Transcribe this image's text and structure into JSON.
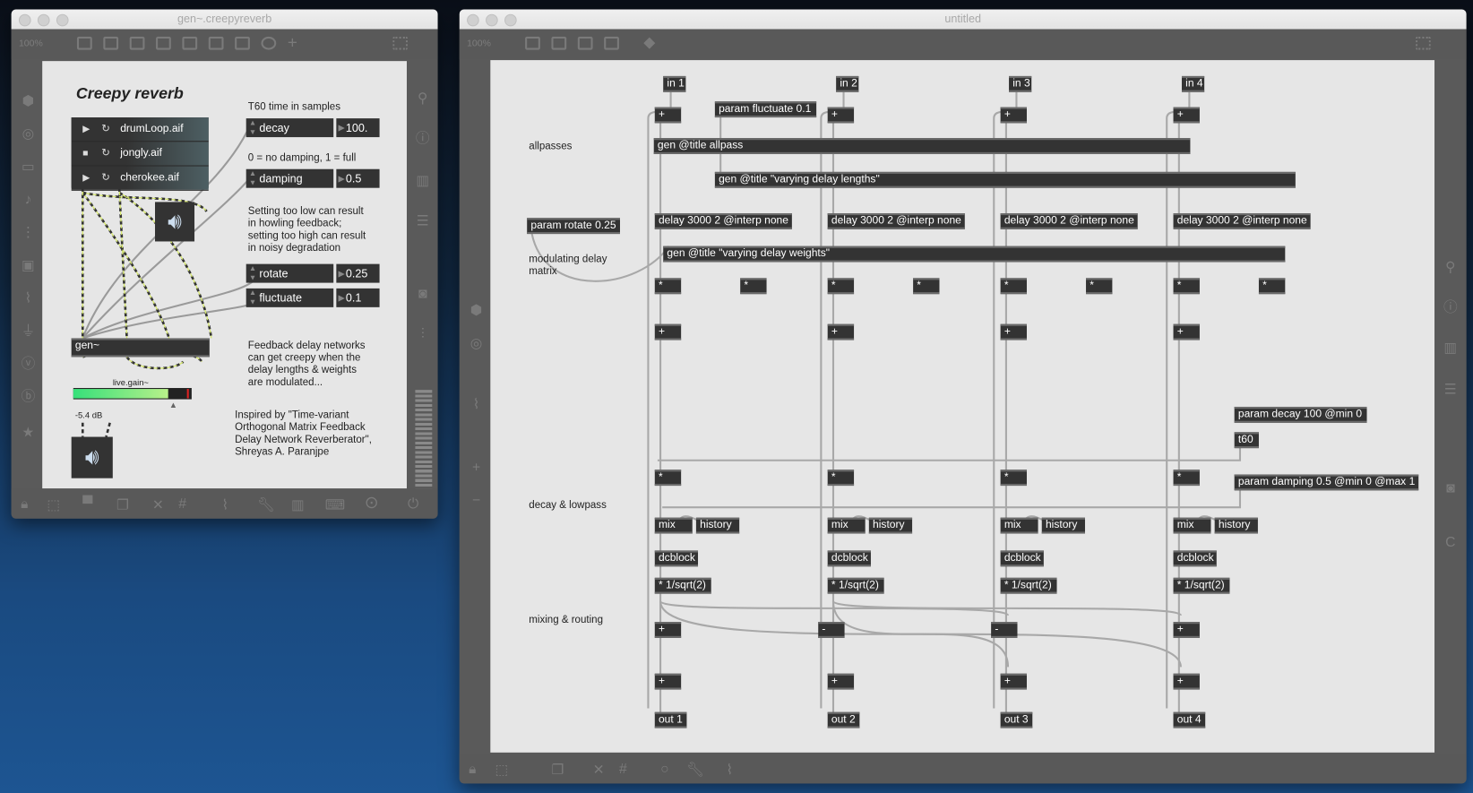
{
  "desktop_colors": {
    "space_top": "#0a0f18",
    "space_bottom": "#1d5592"
  },
  "left_window": {
    "title": "gen~.creepyreverb",
    "zoom": "100%",
    "heading": "Creepy reverb",
    "playlist": [
      "drumLoop.aif",
      "jongly.aif",
      "cherokee.aif"
    ],
    "gen_object": "gen~",
    "gain_label": "live.gain~",
    "gain_value": "-5.4 dB",
    "gain_level": 0.8,
    "t60_comment": "T60 time in samples",
    "damping_comment": "0 = no damping, 1 = full",
    "warning_comment": "Setting too low can result\nin howling feedback;\nsetting too high can result\nin noisy degradation",
    "params": [
      {
        "name": "decay",
        "value": "100."
      },
      {
        "name": "damping",
        "value": "0.5"
      },
      {
        "name": "rotate",
        "value": "0.25"
      },
      {
        "name": "fluctuate",
        "value": "0.1"
      }
    ],
    "feedback_comment": "Feedback delay networks\ncan get creepy when the\ndelay lengths & weights\nare modulated...",
    "credit_comment": "Inspired by \"Time-variant\nOrthogonal Matrix Feedback\nDelay Network Reverberator\",\nShreyas A. Paranjpe"
  },
  "right_window": {
    "title": "untitled",
    "zoom": "100%",
    "comments": [
      "allpasses",
      "modulating delay\nmatrix",
      "decay & lowpass",
      "mixing & routing"
    ],
    "objects": [
      "in 1",
      "in 2",
      "in 3",
      "in 4",
      "+",
      "+",
      "+",
      "+",
      "param fluctuate 0.1",
      "gen @title allpass",
      "gen @title \"varying delay lengths\"",
      "delay 3000 2 @interp none",
      "delay 3000 2 @interp none",
      "delay 3000 2 @interp none",
      "delay 3000 2 @interp none",
      "param rotate 0.25",
      "gen @title \"varying delay weights\"",
      "*",
      "*",
      "*",
      "*",
      "*",
      "*",
      "*",
      "*",
      "+",
      "+",
      "+",
      "+",
      "param decay 100 @min 0",
      "t60",
      "*",
      "*",
      "*",
      "*",
      "param damping 0.5 @min 0 @max 1",
      "mix",
      "history",
      "mix",
      "history",
      "mix",
      "history",
      "mix",
      "history",
      "dcblock",
      "dcblock",
      "dcblock",
      "dcblock",
      "* 1/sqrt(2)",
      "* 1/sqrt(2)",
      "* 1/sqrt(2)",
      "* 1/sqrt(2)",
      "+",
      "-",
      "-",
      "+",
      "+",
      "+",
      "+",
      "+",
      "out 1",
      "out 2",
      "out 3",
      "out 4"
    ]
  }
}
